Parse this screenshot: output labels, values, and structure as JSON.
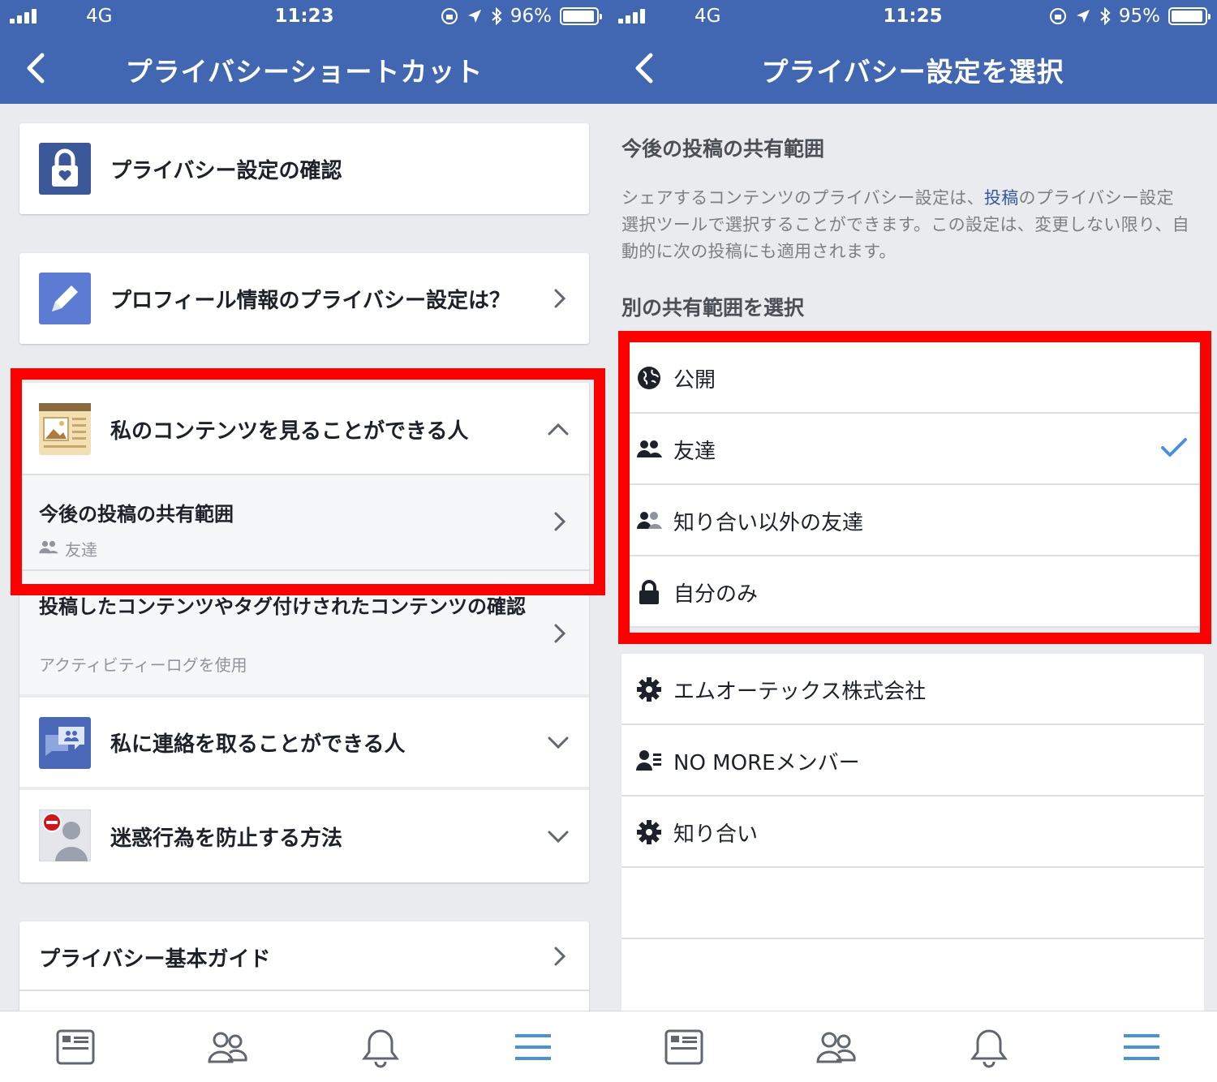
{
  "left": {
    "status": {
      "network": "4G",
      "time": "11:23",
      "battery": "96%",
      "battery_level": 0.96
    },
    "nav_title": "プライバシーショートカット",
    "items": {
      "check_privacy": "プライバシー設定の確認",
      "profile_privacy": "プロフィール情報のプライバシー設定は？",
      "who_can_see": "私のコンテンツを見ることができる人",
      "future_posts_title": "今後の投稿の共有範囲",
      "future_posts_value": "友達",
      "review_posts_title": "投稿したコンテンツやタグ付けされたコンテンツの確認",
      "review_posts_sub": "アクティビティーログを使用",
      "who_can_contact": "私に連絡を取ることができる人",
      "stop_bothering": "迷惑行為を防止する方法",
      "privacy_basics": "プライバシー基本ガイド"
    }
  },
  "right": {
    "status": {
      "network": "4G",
      "time": "11:25",
      "battery": "95%",
      "battery_level": 0.95
    },
    "nav_title": "プライバシー設定を選択",
    "section_title": "今後の投稿の共有範囲",
    "description_pre": "シェアするコンテンツのプライバシー設定は、",
    "description_link": "投稿",
    "description_post": "のプライバシー設定選択ツールで選択することができます。この設定は、変更しない限り、自動的に次の投稿にも適用されます。",
    "choose_title": "別の共有範囲を選択",
    "options": [
      "公開",
      "友達",
      "知り合い以外の友達",
      "自分のみ"
    ],
    "selected_option": "友達",
    "lists": [
      "エムオーテックス株式会社",
      "NO MOREメンバー",
      "知り合い"
    ]
  },
  "colors": {
    "brand": "#4267b2",
    "highlight": "#ff0000",
    "check": "#4a90e2",
    "tab_active": "#4a90e2"
  }
}
